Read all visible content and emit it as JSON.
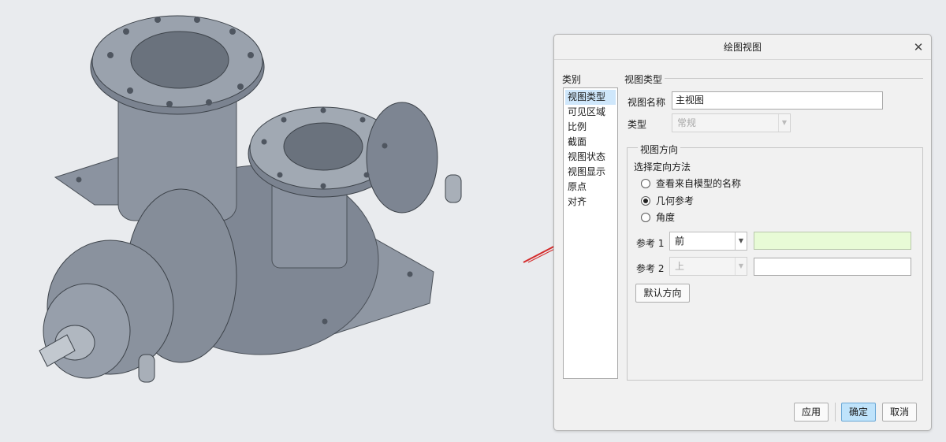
{
  "dialog": {
    "title": "绘图视图",
    "close_icon": "close-icon",
    "category_label": "类别",
    "categories": [
      "视图类型",
      "可见区域",
      "比例",
      "截面",
      "视图状态",
      "视图显示",
      "原点",
      "对齐"
    ],
    "selected_category": 0,
    "view_type_group": "视图类型",
    "view_name_label": "视图名称",
    "view_name_value": "主视图",
    "type_label": "类型",
    "type_value": "常规",
    "orientation": {
      "group_label": "视图方向",
      "method_label": "选择定向方法",
      "options": [
        "查看来自模型的名称",
        "几何参考",
        "角度"
      ],
      "selected": 1,
      "ref1_label": "参考 1",
      "ref1_value": "前",
      "ref2_label": "参考 2",
      "ref2_value": "上",
      "default_button": "默认方向"
    },
    "buttons": {
      "apply": "应用",
      "ok": "确定",
      "cancel": "取消"
    }
  },
  "colors": {
    "accent_button": "#bfe3fb",
    "ref1_field": "#e8fbd6",
    "annotation_arrow": "#d42b2b",
    "model_metal": "#8a93a0"
  }
}
